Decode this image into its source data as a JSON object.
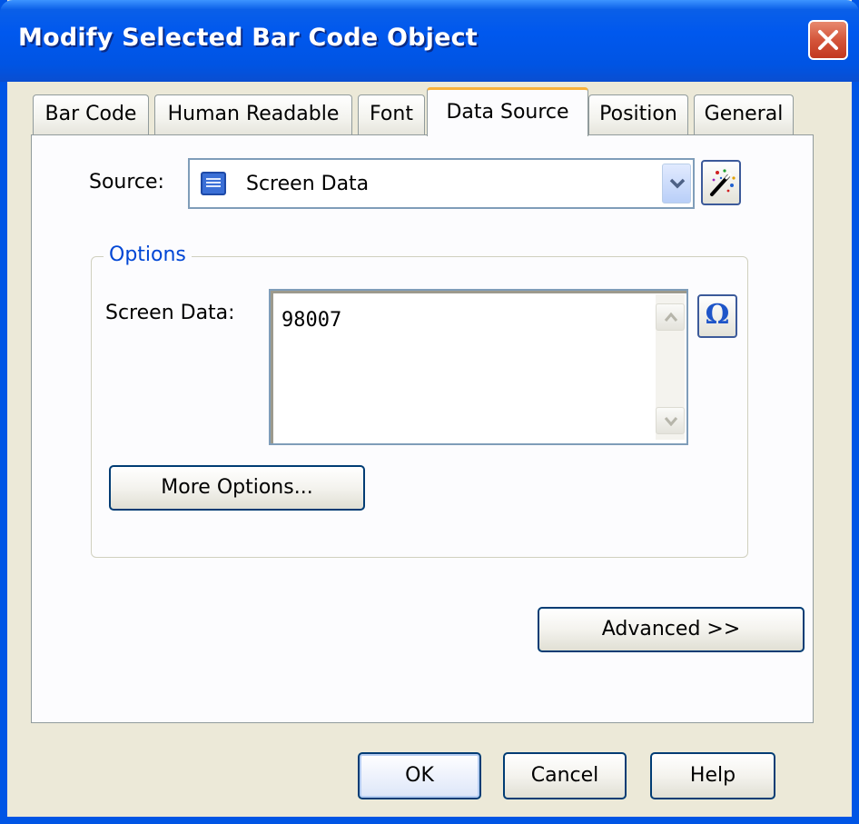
{
  "window": {
    "title": "Modify Selected Bar Code Object"
  },
  "tabs": [
    {
      "label": "Bar Code",
      "active": false
    },
    {
      "label": "Human Readable",
      "active": false
    },
    {
      "label": "Font",
      "active": false
    },
    {
      "label": "Data Source",
      "active": true
    },
    {
      "label": "Position",
      "active": false
    },
    {
      "label": "General",
      "active": false
    }
  ],
  "source": {
    "label": "Source:",
    "selected": "Screen Data",
    "icon": "screen-data-icon",
    "wizard_icon": "magic-wand-icon"
  },
  "options": {
    "legend": "Options",
    "screen_data_label": "Screen Data:",
    "screen_data_value": "98007",
    "insert_symbol_glyph": "Ω",
    "more_options_label": "More Options..."
  },
  "advanced_label": "Advanced >>",
  "footer": {
    "ok_label": "OK",
    "cancel_label": "Cancel",
    "help_label": "Help"
  },
  "colors": {
    "titlebar": "#0054e3",
    "face": "#ece9d8",
    "panel": "#fcfcfe",
    "active_tab_accent": "#f8b23c",
    "group_legend": "#0046d5"
  }
}
